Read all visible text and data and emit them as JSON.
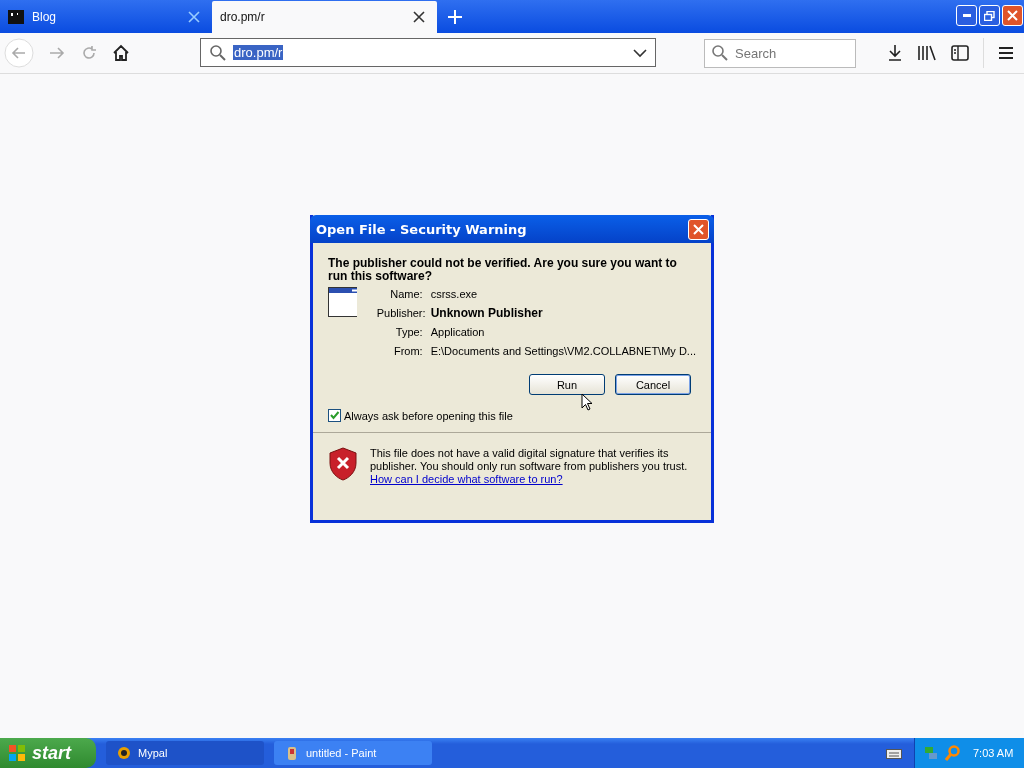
{
  "tabs": [
    {
      "label": "Blog",
      "selected": false
    },
    {
      "label": "dro.pm/r",
      "selected": true
    }
  ],
  "address_bar": {
    "value": "dro.pm/r"
  },
  "search": {
    "placeholder": "Search"
  },
  "dialog": {
    "title": "Open File - Security Warning",
    "question": "The publisher could not be verified.  Are you sure you want to run this software?",
    "fields": [
      {
        "label": "Name:",
        "value": "csrss.exe",
        "bold": false
      },
      {
        "label": "Publisher:",
        "value": "Unknown Publisher",
        "bold": true
      },
      {
        "label": "Type:",
        "value": "Application",
        "bold": false
      },
      {
        "label": "From:",
        "value": "E:\\Documents and Settings\\VM2.COLLABNET\\My D...",
        "bold": false
      }
    ],
    "buttons": [
      {
        "label": "Run",
        "default": false
      },
      {
        "label": "Cancel",
        "default": true
      }
    ],
    "checkbox": {
      "label": "Always ask before opening this file",
      "checked": true
    },
    "warning": "This file does not have a valid digital signature that verifies its publisher.  You should only run software from publishers you trust.",
    "link": "How can I decide what software to run?"
  },
  "taskbar": {
    "start": "start",
    "items": [
      {
        "label": "Mypal",
        "selected": false
      },
      {
        "label": "untitled - Paint",
        "selected": true
      }
    ],
    "clock": "7:03 AM"
  }
}
